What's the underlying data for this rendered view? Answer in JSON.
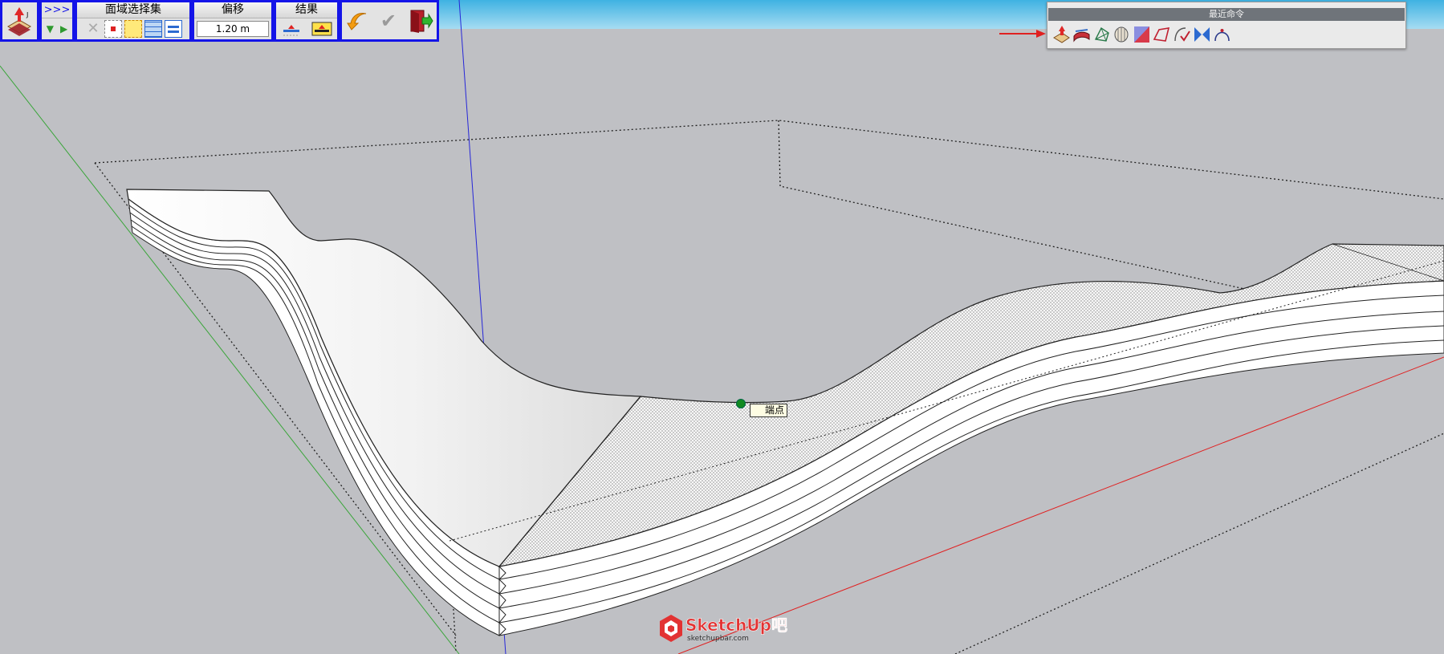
{
  "toolbar": {
    "nav": {
      "top": ">>>",
      "prev": "▼",
      "next": "▶"
    },
    "groups": {
      "selection_label": "面域选择集",
      "offset_label": "偏移",
      "result_label": "结果"
    },
    "offset_value": "1.20 m"
  },
  "recent": {
    "title": "最近命令"
  },
  "viewport": {
    "tooltip": "端点",
    "axes": {
      "red": "#e02020",
      "green": "#3aa53a",
      "blue": "#2626d8"
    }
  },
  "watermark": {
    "brand": "SketchUp",
    "suffix": "吧",
    "url": "sketchupbar.com"
  },
  "colors": {
    "toolbar_border": "#1414e8",
    "background": "#bfc0c4",
    "sky": "#3fb2e2"
  }
}
